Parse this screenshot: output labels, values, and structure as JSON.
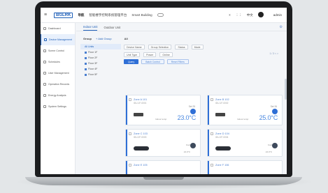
{
  "topbar": {
    "logo": "BGLRK",
    "nav_items": [
      "导航",
      "智能楼宇控制系统管理平台",
      "Smart Building"
    ],
    "right_items": [
      "中文",
      "admin"
    ]
  },
  "sidebar": {
    "items": [
      {
        "label": "Dashboard"
      },
      {
        "label": "Device Management",
        "active": true
      },
      {
        "label": "Scene Control"
      },
      {
        "label": "Schedules"
      },
      {
        "label": "User Management"
      },
      {
        "label": "Operation Records"
      },
      {
        "label": "Energy Analysis"
      },
      {
        "label": "System Settings"
      }
    ]
  },
  "tabs": [
    {
      "label": "Indoor Unit",
      "active": true
    },
    {
      "label": "Outdoor Unit"
    }
  ],
  "group": {
    "title": "Group",
    "add_label": "+ Add Group",
    "all_label": "All"
  },
  "tree": [
    {
      "label": "All Units",
      "selected": true
    },
    {
      "label": "Floor 1F"
    },
    {
      "label": "Floor 2F"
    },
    {
      "label": "Floor 3F"
    },
    {
      "label": "Floor 4F"
    },
    {
      "label": "Floor 5F"
    }
  ],
  "filters": {
    "row1": [
      "Device Name",
      "Group Selection",
      "Status",
      "Mode"
    ],
    "row2": [
      "Unit Type",
      "Power",
      "Online"
    ],
    "buttons": [
      "Query",
      "Batch Control",
      "Reset Filters"
    ],
    "pager": "1 / 3  < >"
  },
  "cards": [
    {
      "name": "Zone A 101",
      "sub": "IDU-1F-0001",
      "set": "Set 25",
      "temp_label": "Indoor temp:",
      "temp": "23.0°C"
    },
    {
      "name": "Zone B 102",
      "sub": "IDU-1F-0002",
      "set": "Set 26",
      "temp_label": "Indoor temp:",
      "temp": "25.0°C"
    },
    {
      "name": "Zone C 103",
      "sub": "IDU-2F-0003",
      "set": "Off",
      "mini": "Cool",
      "mini2": "24.0°C"
    },
    {
      "name": "Zone D 104",
      "sub": "IDU-2F-0004",
      "set": "Off",
      "mini": "Cool",
      "mini2": "24.0°C"
    },
    {
      "name": "Zone E 105"
    },
    {
      "name": "Zone F 106"
    }
  ],
  "colors": {
    "accent": "#2f6fd6",
    "temp": "#4a88e0"
  }
}
